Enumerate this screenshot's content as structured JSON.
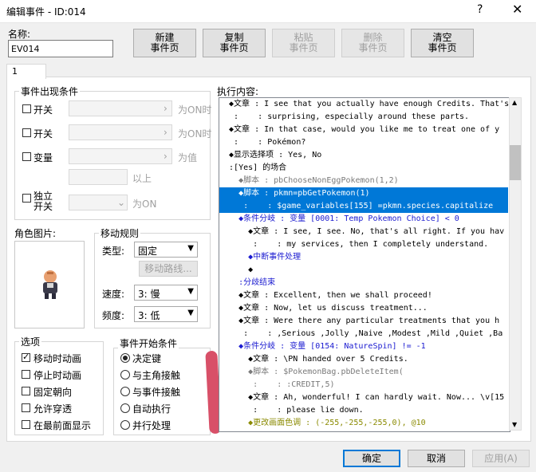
{
  "window": {
    "title": "编辑事件 - ID:014",
    "help": "?",
    "close": "✕"
  },
  "name": {
    "label": "名称:",
    "value": "EV014"
  },
  "toolbar": [
    {
      "label": "新建\n事件页",
      "disabled": false
    },
    {
      "label": "复制\n事件页",
      "disabled": false
    },
    {
      "label": "粘贴\n事件页",
      "disabled": true
    },
    {
      "label": "删除\n事件页",
      "disabled": true
    },
    {
      "label": "清空\n事件页",
      "disabled": false
    }
  ],
  "tab": {
    "label": "1"
  },
  "conditions": {
    "title": "事件出现条件",
    "switch1": {
      "label": "开关",
      "suffix": "为ON时"
    },
    "switch2": {
      "label": "开关",
      "suffix": "为ON时"
    },
    "variable": {
      "label": "变量",
      "suffix": "为值",
      "above": "以上"
    },
    "selfswitch": {
      "label": "独立\n开关",
      "suffix": "为ON"
    }
  },
  "graphic": {
    "title": "角色图片:"
  },
  "movement": {
    "title": "移动规则",
    "type_label": "类型:",
    "type_value": "固定",
    "route_button": "移动路线...",
    "speed_label": "速度:",
    "speed_value": "3: 慢",
    "freq_label": "频度:",
    "freq_value": "3: 低"
  },
  "options": {
    "title": "选项",
    "items": [
      {
        "label": "移动时动画",
        "checked": true
      },
      {
        "label": "停止时动画",
        "checked": false
      },
      {
        "label": "固定朝向",
        "checked": false
      },
      {
        "label": "允许穿透",
        "checked": false
      },
      {
        "label": "在最前面显示",
        "checked": false
      }
    ]
  },
  "trigger": {
    "title": "事件开始条件",
    "items": [
      {
        "label": "决定键",
        "checked": true
      },
      {
        "label": "与主角接触",
        "checked": false
      },
      {
        "label": "与事件接触",
        "checked": false
      },
      {
        "label": "自动执行",
        "checked": false
      },
      {
        "label": "并行处理",
        "checked": false
      }
    ]
  },
  "commands": {
    "title": "执行内容:",
    "lines": [
      {
        "text": "  ◆文章 : I see that you actually have enough Credits. That's",
        "color": "#000000",
        "selected": false
      },
      {
        "text": "   :    : surprising, especially around these parts.",
        "color": "#000000",
        "selected": false
      },
      {
        "text": "  ◆文章 : In that case, would you like me to treat one of y",
        "color": "#000000",
        "selected": false
      },
      {
        "text": "   :    : Pokémon?",
        "color": "#000000",
        "selected": false
      },
      {
        "text": "  ◆显示选择项 : Yes, No",
        "color": "#000000",
        "selected": false
      },
      {
        "text": "  :[Yes] 的场合",
        "color": "#000000",
        "selected": false
      },
      {
        "text": "    ◆脚本 : pbChooseNonEggPokemon(1,2)",
        "color": "#7a7a7a",
        "selected": false
      },
      {
        "text": "    ◆脚本 : pkmn=pbGetPokemon(1)",
        "color": "#ffffff",
        "selected": true
      },
      {
        "text": "     :    : $game_variables[155] =pkmn.species.capitalize",
        "color": "#ffffff",
        "selected": true
      },
      {
        "text": "    ◆条件分岐 : 变量 [0001: Temp Pokemon Choice] < 0",
        "color": "#1a1ad0",
        "selected": false
      },
      {
        "text": "      ◆文章 : I see, I see. No, that's all right. If you hav",
        "color": "#000000",
        "selected": false
      },
      {
        "text": "       :    : my services, then I completely understand.",
        "color": "#000000",
        "selected": false
      },
      {
        "text": "      ◆中断事件处理",
        "color": "#1a1ad0",
        "selected": false
      },
      {
        "text": "      ◆",
        "color": "#000000",
        "selected": false
      },
      {
        "text": "    :分歧结束",
        "color": "#1a1ad0",
        "selected": false
      },
      {
        "text": "    ◆文章 : Excellent, then we shall proceed!",
        "color": "#000000",
        "selected": false
      },
      {
        "text": "    ◆文章 : Now, let us discuss treatment...",
        "color": "#000000",
        "selected": false
      },
      {
        "text": "    ◆文章 : Were there any particular treatments that you h",
        "color": "#000000",
        "selected": false
      },
      {
        "text": "     :    : ,Serious ,Jolly ,Naive ,Modest ,Mild ,Quiet ,Ba",
        "color": "#000000",
        "selected": false
      },
      {
        "text": "    ◆条件分岐 : 变量 [0154: NatureSpin] != -1",
        "color": "#1a1ad0",
        "selected": false
      },
      {
        "text": "      ◆文章 : \\PN handed over 5 Credits.",
        "color": "#000000",
        "selected": false
      },
      {
        "text": "      ◆脚本 : $PokemonBag.pbDeleteItem(",
        "color": "#7a7a7a",
        "selected": false
      },
      {
        "text": "       :    : :CREDIT,5)",
        "color": "#7a7a7a",
        "selected": false
      },
      {
        "text": "      ◆文章 : Ah, wonderful! I can hardly wait. Now... \\v[15",
        "color": "#000000",
        "selected": false
      },
      {
        "text": "       :    : please lie down.",
        "color": "#000000",
        "selected": false
      },
      {
        "text": "      ◆更改画面色调 : (-255,-255,-255,0), @10",
        "color": "#8a8a00",
        "selected": false
      }
    ]
  },
  "footer": {
    "ok": "确定",
    "cancel": "取消",
    "apply": "应用(A)"
  },
  "colors": {
    "accent": "#0078d7",
    "annotation": "#d85068"
  }
}
